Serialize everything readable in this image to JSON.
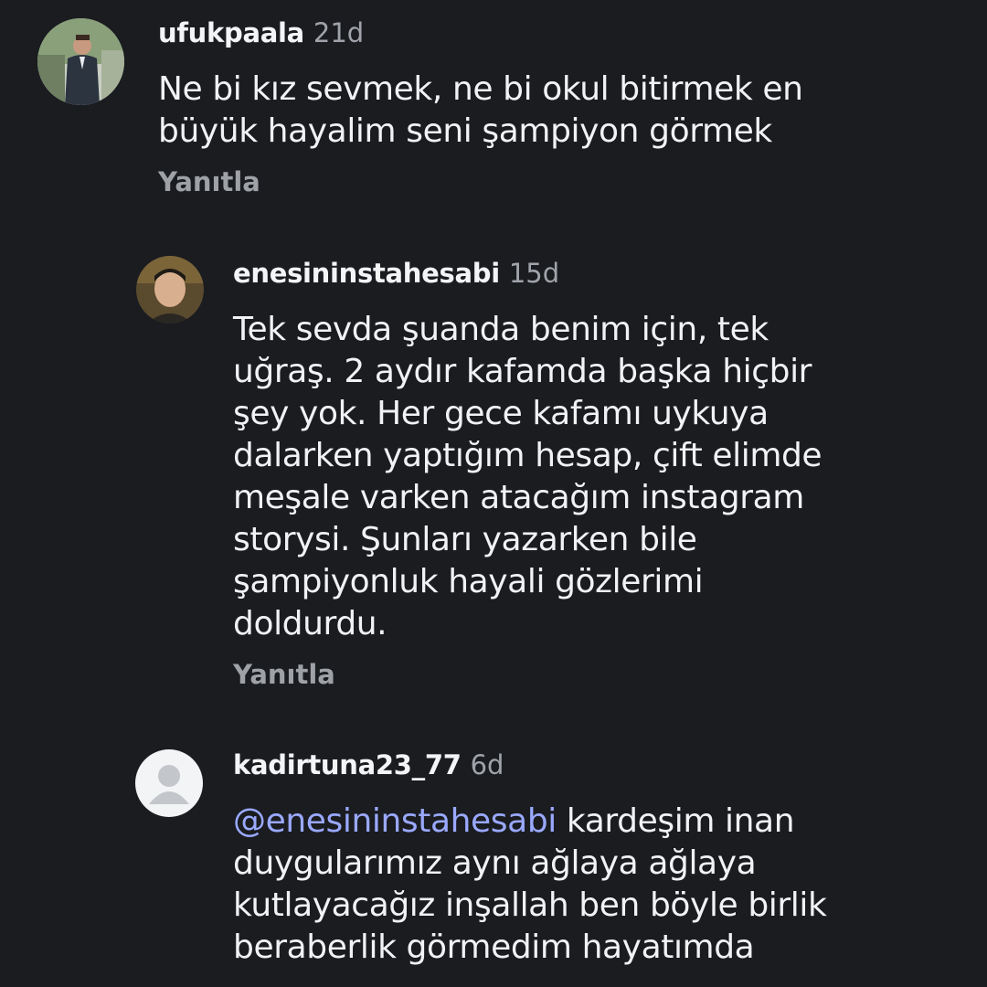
{
  "comments": [
    {
      "username": "ufukpaala",
      "time": "21d",
      "avatar_icon": "user-photo-avatar",
      "text": "Ne bi kız sevmek, ne bi okul bitirmek en\nbüyük hayalim seni şampiyon görmek",
      "reply_label": "Yanıtla"
    },
    {
      "username": "enesininstahesabi",
      "time": "15d",
      "avatar_icon": "user-photo-avatar",
      "text": "Tek sevda şuanda benim için, tek\nuğraş. 2 aydır kafamda başka hiçbir\nşey yok. Her gece kafamı uykuya\ndalarken yaptığım hesap, çift elimde\nmeşale varken atacağım instagram\nstorysi. Şunları yazarken bile\nşampiyonluk hayali gözlerimi\ndoldurdu.",
      "reply_label": "Yanıtla"
    },
    {
      "username": "kadirtuna23_77",
      "time": "6d",
      "avatar_icon": "default-user-avatar",
      "mention": "@enesininstahesabi",
      "text": " kardeşim inan\nduygularımız aynı ağlaya ağlaya\nkutlayacağız inşallah ben böyle birlik\nberaberlik görmedim hayatımda"
    }
  ],
  "colors": {
    "background": "#1a1c20",
    "mention": "#9aa9ff",
    "secondary_text": "#9ea1a6"
  }
}
